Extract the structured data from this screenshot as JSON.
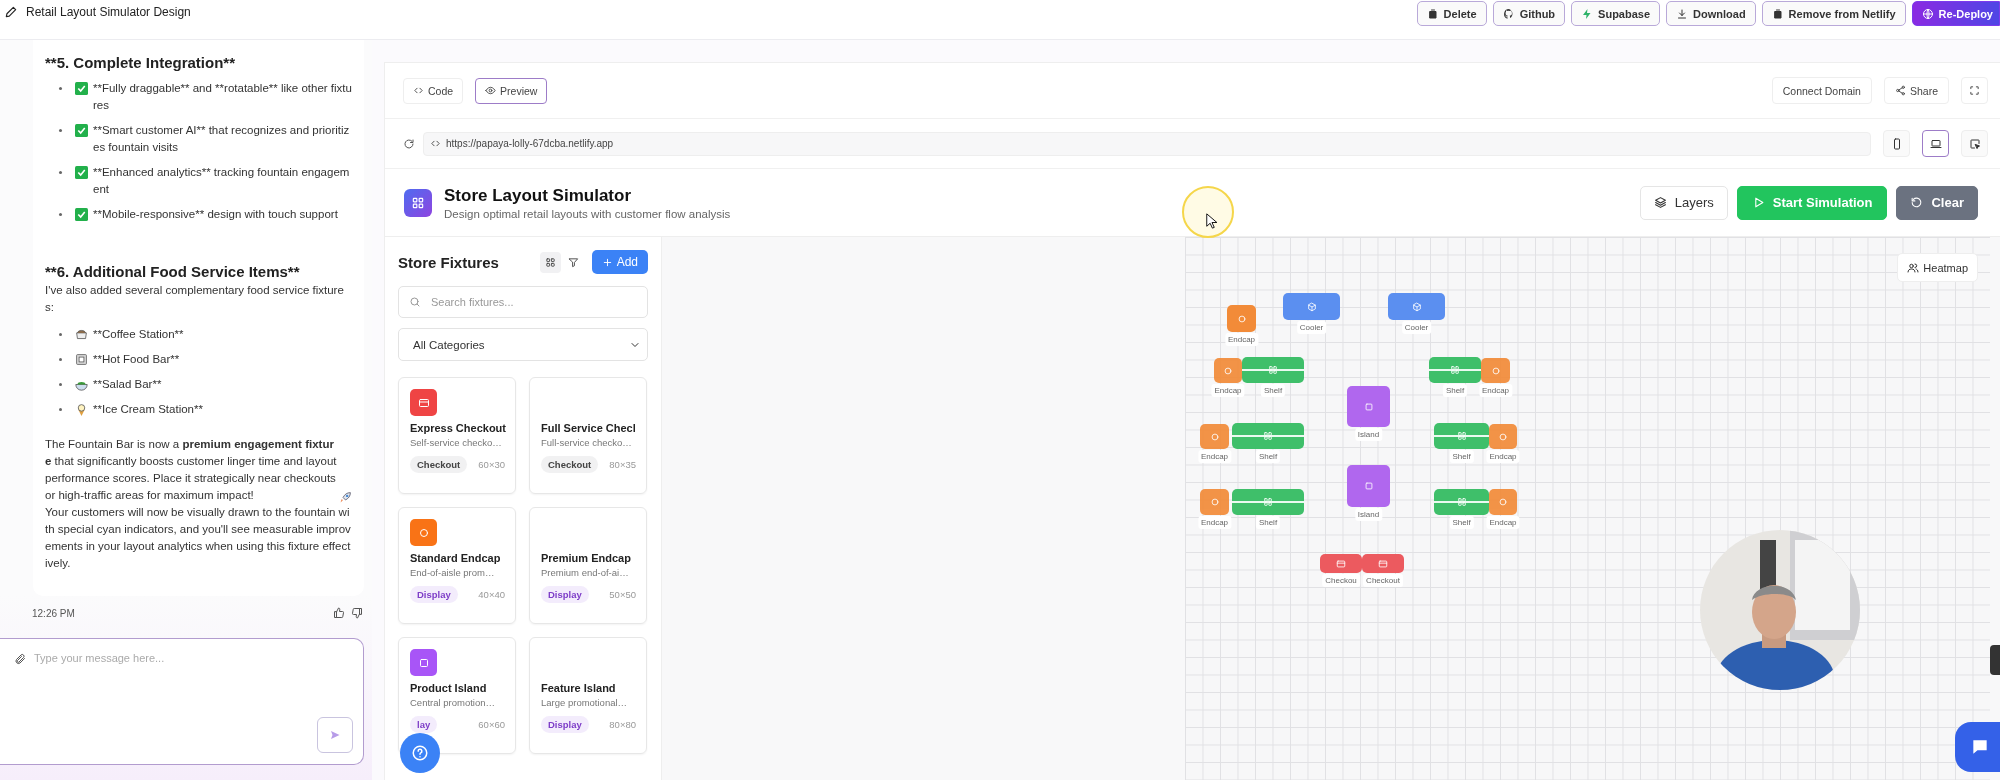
{
  "topbar": {
    "title": "Retail Layout Simulator Design",
    "actions": [
      {
        "kind": "trash",
        "label": "Delete",
        "primary": false
      },
      {
        "kind": "github",
        "label": "Github",
        "primary": false
      },
      {
        "kind": "bolt",
        "label": "Supabase",
        "primary": false
      },
      {
        "kind": "download",
        "label": "Download",
        "primary": false
      },
      {
        "kind": "trash",
        "label": "Remove from Netlify",
        "primary": false
      },
      {
        "kind": "globe",
        "label": "Re-Deploy",
        "primary": true
      }
    ]
  },
  "chat": {
    "heading_5": "**5. Complete Integration**",
    "features": [
      "**Fully draggable** and **rotatable** like other fixtures",
      "**Smart customer AI** that recognizes and prioritizes fountain visits",
      "**Enhanced analytics** tracking fountain engagement",
      "**Mobile-responsive** design with touch support"
    ],
    "heading_6": "**6. Additional Food Service Items**",
    "intro": "I've also added several complementary food service fixtures:",
    "food_items": [
      {
        "kind": "coffee",
        "text": "**Coffee Station**"
      },
      {
        "kind": "hotfood",
        "text": "**Hot Food Bar**"
      },
      {
        "kind": "salad",
        "text": "**Salad Bar**"
      },
      {
        "kind": "icecream",
        "text": "**Ice Cream Station**"
      }
    ],
    "paragraph": "The Fountain Bar is now a **premium engagement fixture** that significantly boosts customer linger time and layout performance scores. Place it strategically near checkouts or high-traffic areas for maximum impact!",
    "paragraph_2": "Your customers will now be visually drawn to the fountain with special cyan indicators, and you'll see measurable improvements in your layout analytics when using this fixture effectively.",
    "time": "12:26 PM",
    "input": {
      "placeholder": "Type your message here..."
    }
  },
  "preview": {
    "tabs": [
      {
        "kind": "code",
        "label": "Code",
        "selected": false
      },
      {
        "kind": "eye",
        "label": "Preview",
        "selected": true
      }
    ],
    "actions": [
      {
        "kind": "plain",
        "label": "Connect Domain"
      },
      {
        "kind": "share",
        "label": "Share"
      }
    ],
    "url": "https://papaya-lolly-67dcba.netlify.app",
    "devices": [
      {
        "kind": "phone",
        "selected": false
      },
      {
        "kind": "laptop",
        "selected": true
      },
      {
        "kind": "inspect",
        "selected": false
      }
    ]
  },
  "app": {
    "title": "Store Layout Simulator",
    "subtitle": "Design optimal retail layouts with customer flow analysis",
    "actions": [
      {
        "kind": "layers",
        "label": "Layers"
      },
      {
        "kind": "start",
        "label": "Start Simulation"
      },
      {
        "kind": "clear",
        "label": "Clear"
      }
    ]
  },
  "fixtures_panel": {
    "title": "Store Fixtures",
    "tools": [
      {
        "kind": "grid",
        "selected": true
      },
      {
        "kind": "filter",
        "selected": false
      }
    ],
    "add_label": "Add",
    "search_placeholder": "Search fixtures...",
    "category": "All Categories",
    "items": [
      {
        "kind": "checkout",
        "icon_visible": true,
        "name": "Express Checkout",
        "description": "Self-service checko…",
        "tag": "Checkout",
        "size": "60×30"
      },
      {
        "kind": "checkout",
        "icon_visible": false,
        "name": "Full Service Checl",
        "description": "Full-service checko…",
        "tag": "Checkout",
        "size": "80×35"
      },
      {
        "kind": "endcap",
        "icon_visible": true,
        "name": "Standard Endcap",
        "description": "End-of-aisle prom…",
        "tag": "Display",
        "size": "40×40"
      },
      {
        "kind": "endcap",
        "icon_visible": false,
        "name": "Premium Endcap",
        "description": "Premium end-of-ai…",
        "tag": "Display",
        "size": "50×50"
      },
      {
        "kind": "island",
        "icon_visible": true,
        "name": "Product Island",
        "description": "Central promotion…",
        "tag": "lay",
        "size": "60×60"
      },
      {
        "kind": "island",
        "icon_visible": false,
        "name": "Feature Island",
        "description": "Large promotional…",
        "tag": "Display",
        "size": "80×80"
      }
    ]
  },
  "canvas": {
    "heatmap_label": "Heatmap",
    "fixtures": [
      {
        "kind": "endcap",
        "label": "Endcap"
      },
      {
        "kind": "cooler",
        "label": "Cooler"
      },
      {
        "kind": "cooler",
        "label": "Cooler"
      },
      {
        "kind": "endcap",
        "label": "Endcap"
      },
      {
        "kind": "shelf",
        "label": "Shelf"
      },
      {
        "kind": "shelf",
        "label": "Shelf"
      },
      {
        "kind": "endcap",
        "label": "Endcap"
      },
      {
        "kind": "island",
        "label": "Island"
      },
      {
        "kind": "endcap",
        "label": "Endcap"
      },
      {
        "kind": "shelf",
        "label": "Shelf"
      },
      {
        "kind": "shelf",
        "label": "Shelf"
      },
      {
        "kind": "endcap",
        "label": "Endcap"
      },
      {
        "kind": "island",
        "label": "Island"
      },
      {
        "kind": "endcap",
        "label": "Endcap"
      },
      {
        "kind": "shelf",
        "label": "Shelf"
      },
      {
        "kind": "shelf",
        "label": "Shelf"
      },
      {
        "kind": "endcap",
        "label": "Endcap"
      },
      {
        "kind": "checkout",
        "label": "Checkou"
      },
      {
        "kind": "checkout",
        "label": "Checkout"
      }
    ]
  }
}
